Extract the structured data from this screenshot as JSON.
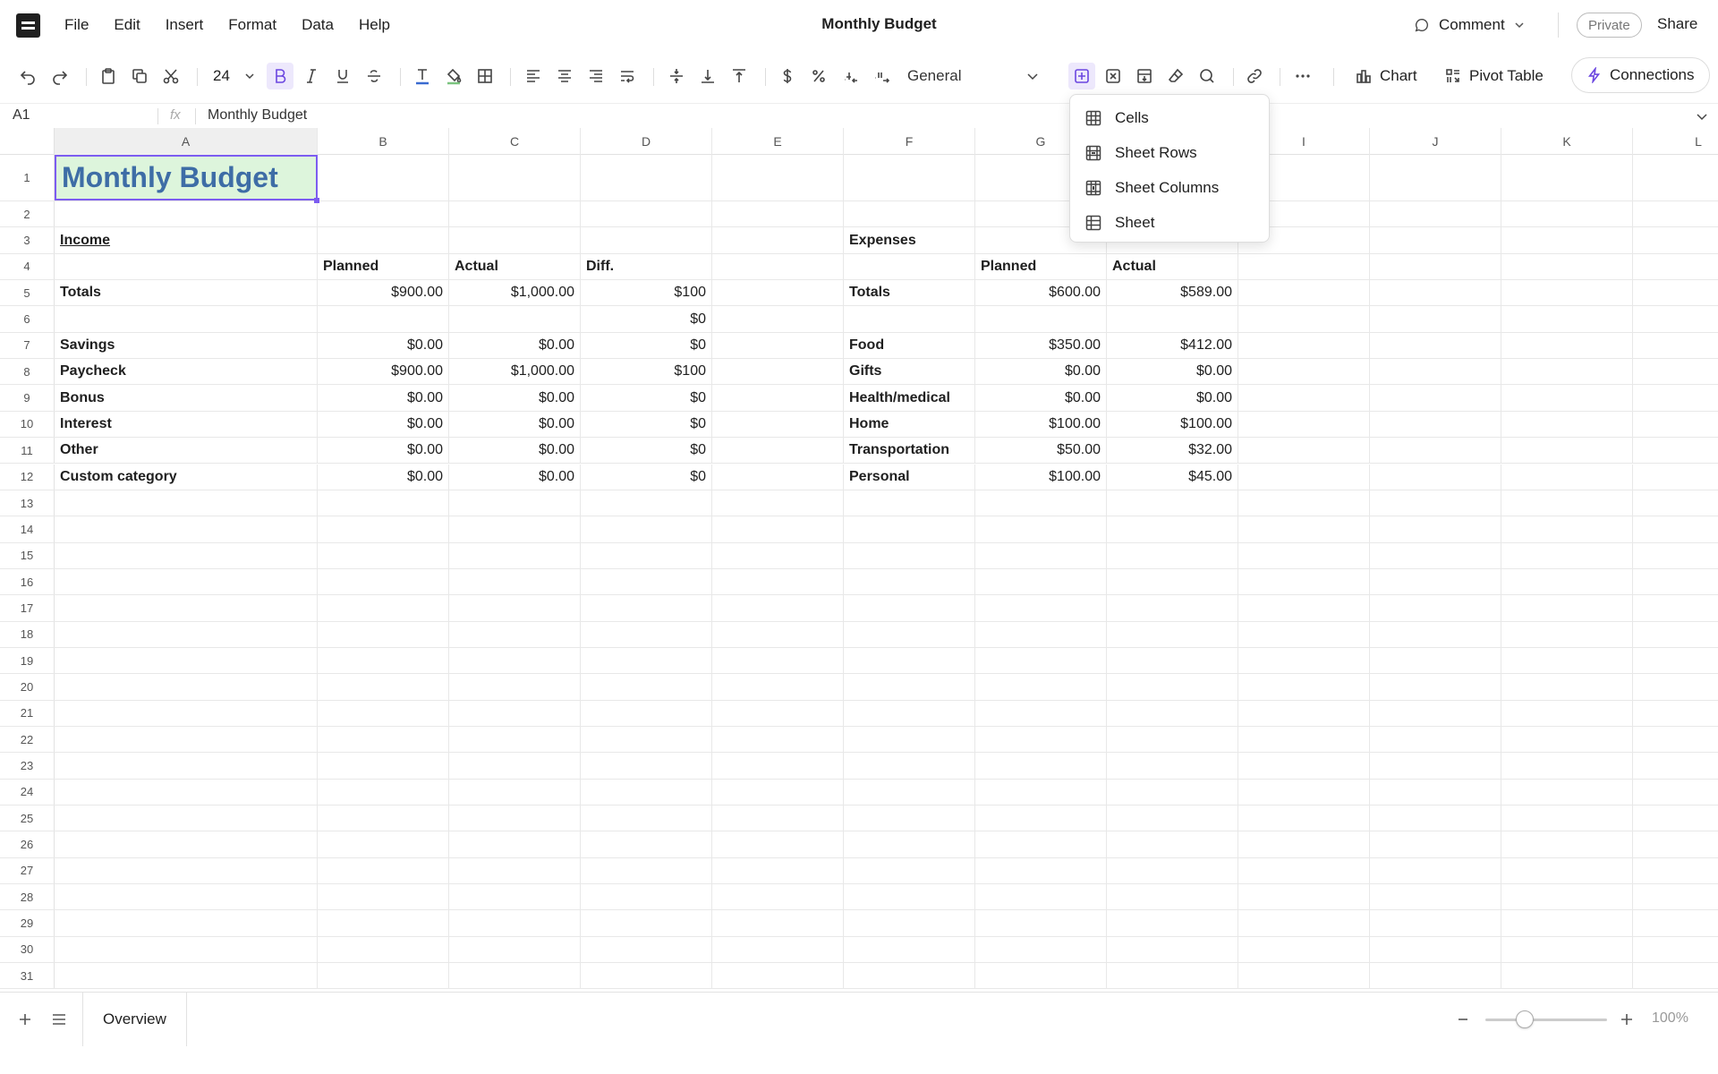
{
  "menubar": {
    "items": [
      "File",
      "Edit",
      "Insert",
      "Format",
      "Data",
      "Help"
    ],
    "doc_title": "Monthly Budget",
    "comment_label": "Comment",
    "private_label": "Private",
    "share_label": "Share"
  },
  "toolbar": {
    "font_size": "24",
    "number_format": "General",
    "chart_label": "Chart",
    "pivot_label": "Pivot Table",
    "connections_label": "Connections"
  },
  "formula_bar": {
    "cell_ref": "A1",
    "fx": "fx",
    "value": "Monthly Budget"
  },
  "grid": {
    "columns": [
      "A",
      "B",
      "C",
      "D",
      "E",
      "F",
      "G",
      "H",
      "I",
      "J",
      "K",
      "L"
    ],
    "selected_column": "A",
    "selected_cell": "A1",
    "row_count": 31,
    "cells": {
      "A1": "Monthly Budget",
      "A3": "Income",
      "F3": "Expenses",
      "B4": "Planned",
      "C4": "Actual",
      "D4": "Diff.",
      "G4": "Planned",
      "H4": "Actual",
      "A5": "Totals",
      "B5": "$900.00",
      "C5": "$1,000.00",
      "D5": "$100",
      "F5": "Totals",
      "G5": "$600.00",
      "H5": "$589.00",
      "D6": "$0",
      "A7": "Savings",
      "B7": "$0.00",
      "C7": "$0.00",
      "D7": "$0",
      "F7": "Food",
      "G7": "$350.00",
      "H7": "$412.00",
      "A8": "Paycheck",
      "B8": "$900.00",
      "C8": "$1,000.00",
      "D8": "$100",
      "F8": "Gifts",
      "G8": "$0.00",
      "H8": "$0.00",
      "A9": "Bonus",
      "B9": "$0.00",
      "C9": "$0.00",
      "D9": "$0",
      "F9": "Health/medical",
      "G9": "$0.00",
      "H9": "$0.00",
      "A10": "Interest",
      "B10": "$0.00",
      "C10": "$0.00",
      "D10": "$0",
      "F10": "Home",
      "G10": "$100.00",
      "H10": "$100.00",
      "A11": "Other",
      "B11": "$0.00",
      "C11": "$0.00",
      "D11": "$0",
      "F11": "Transportation",
      "G11": "$50.00",
      "H11": "$32.00",
      "A12": "Custom category",
      "B12": "$0.00",
      "C12": "$0.00",
      "D12": "$0",
      "F12": "Personal",
      "G12": "$100.00",
      "H12": "$45.00"
    }
  },
  "insert_dropdown": {
    "items": [
      {
        "label": "Cells",
        "icon": "grid-icon"
      },
      {
        "label": "Sheet Rows",
        "icon": "rows-icon"
      },
      {
        "label": "Sheet Columns",
        "icon": "columns-icon"
      },
      {
        "label": "Sheet",
        "icon": "sheet-icon"
      }
    ]
  },
  "bottombar": {
    "sheet_tab": "Overview",
    "zoom": "100%",
    "zoom_level": 0.4
  }
}
